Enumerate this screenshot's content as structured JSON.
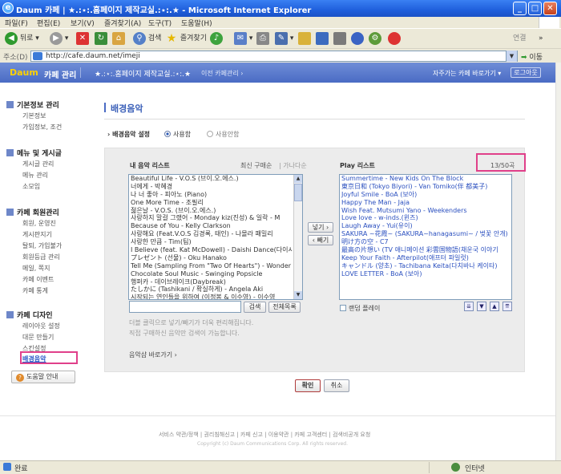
{
  "window": {
    "title": "Daum 카페 | ★.:⋆:.홈페이지 제작교실.:⋆:.★ - Microsoft Internet Explorer"
  },
  "menu": [
    "파일(F)",
    "편집(E)",
    "보기(V)",
    "즐겨찾기(A)",
    "도구(T)",
    "도움말(H)"
  ],
  "toolbar": {
    "back": "뒤로",
    "search": "검색",
    "favorites": "즐겨찾기",
    "links": "연결"
  },
  "address": {
    "label": "주소(D)",
    "url": "http://cafe.daum.net/imeji",
    "go": "이동"
  },
  "cafe": {
    "logo": "Daum",
    "admin": "카페 관리",
    "name": "★.:⋆:.홈페이지 제작교실.:⋆:.★",
    "prev": "이전 카페관리 ›",
    "frequent": "자주가는 카페 바로가기 ▾",
    "logout": "로그아웃"
  },
  "sidebar": {
    "basic": {
      "title": "기본정보 관리",
      "items": [
        "기본정보",
        "가입정보, 조건"
      ]
    },
    "menu": {
      "title": "메뉴 및 게시글",
      "items": [
        "게시글 관리",
        "메뉴 관리",
        "소모임"
      ]
    },
    "member": {
      "title": "카페 회원관리",
      "items": [
        "회원, 운영진",
        "게시판지기",
        "탈퇴, 가입불가",
        "회원등급 관리",
        "메일, 쪽지",
        "카페 이벤트",
        "카페 통계"
      ]
    },
    "design": {
      "title": "카페 디자인",
      "items": [
        "레이아웃 설정",
        "대문 만들기",
        "스킨설정",
        "배경음악"
      ]
    },
    "help": "도움말 안내"
  },
  "main": {
    "title": "배경음악",
    "setting_label": "배경음악 설정",
    "use": "사용함",
    "nouse": "사용안함",
    "my_list_title": "내 음악 리스트",
    "sort_recent": "최신 구매순",
    "sort_abc": "가나다순",
    "play_list_title": "Play 리스트",
    "count": "13/50곡",
    "add_btn": "넣기 ›",
    "remove_btn": "‹ 빼기",
    "search_btn": "검색",
    "all_list_btn": "전체목록",
    "random": "랜덤 플레이",
    "note1": "더블 클릭으로 넣기/빼기가 더욱 편리해집니다.",
    "note2": "직접 구매하신 음악만 검색이 가능합니다.",
    "shop_link": "음악샵 바로가기 ›",
    "confirm": "확인",
    "cancel": "취소",
    "my_list": [
      "Beautiful Life - V.O.S (브이.오.에스.)",
      "너에게 - 박혜경",
      "나 너 좋아 - 피아노 (Piano)",
      "One More Time - 조필리",
      "젊은날 - V.O.S. (브이.오.에스.)",
      "사랑하지 말걸 그랬어 - Monday kiz(진성) & 일락 - M",
      "Because of You - Kelly Clarkson",
      "사랑해요 (Feat.V.O.S 김경록, 태인) - 나몰라 패밀리",
      "사랑한 만큼 - Tim(팀)",
      "I Believe (feat. Kat McDowell) - Daishi Dance(다이시",
      "プレゼント (선물) - Oku Hanako",
      "Tell Me (Sampling From \"Two Of Hearts\") - Wonder",
      "Chocolate Soul Music - Swinging Popsicle",
      "행퍼카 - 데이브레이크(Daybreak)",
      "たしかに (Tashikani / 확실하게) - Angela Aki",
      "시작되는 연인들을 위하여 (이정봉 & 이수영) - 이수영"
    ],
    "play_list": [
      "Summertime - New Kids On The Block",
      "東京日和 (Tokyo Biyori) - Van Tomiko(伴 都美子)",
      "Joyful Smile - BoA (보아)",
      "Happy The Man - Jaja",
      "Wish Feat. Mutsumi Yano - Weekenders",
      "Love love - w-inds.(윈즈)",
      "Laugh Away - Yui(유이)",
      "SAKURA ~花霞~ (SAKURA~hanagasumi~ / 벚꽃 안개)",
      "明け方の空 - C7",
      "最高の片想い (TV 애니메이션 彩雲国物語(채운국 이야기",
      "Keep Your Faith - Afterpilot(애프터 파일럿)",
      "キャンドル (양초) - Tachibana Keita(다치바나 케이타)",
      "LOVE LETTER - BoA (보아)"
    ]
  },
  "footer": {
    "links": "서비스 약관/정책 | 권리침해신고 | 카페 신고 | 이용약관 | 카페 고객센터 | 검색비공개 요청",
    "copyright": "Copyright (c) Daum Communications Corp. All rights reserved."
  },
  "status": {
    "done": "완료",
    "zone": "인터넷"
  }
}
